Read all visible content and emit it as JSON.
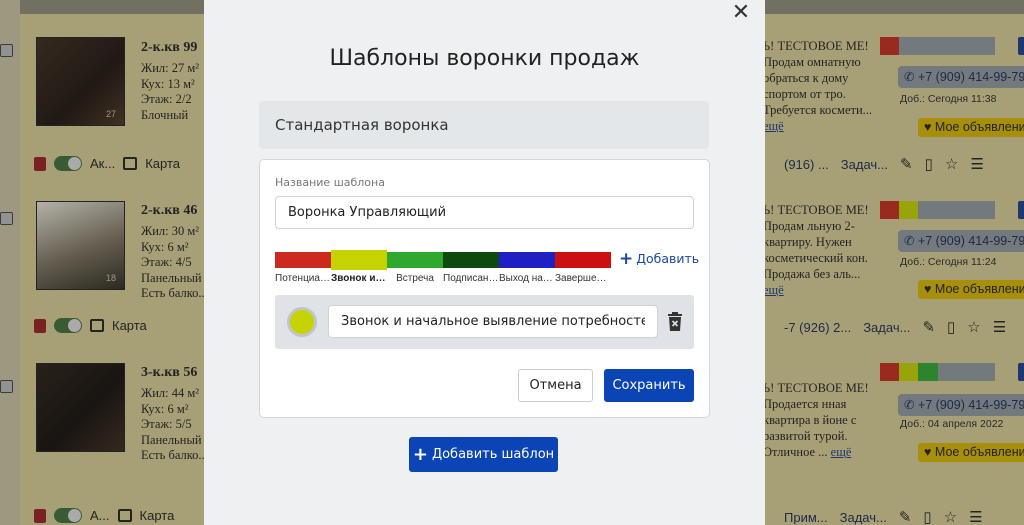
{
  "modal": {
    "title": "Шаблоны воронки продаж",
    "funnel_name": "Стандартная воронка",
    "template_label": "Название шаблона",
    "template_name": "Воронка Управляющий",
    "add_stage_label": "Добавить",
    "selected_stage": {
      "color": "#c5d400",
      "name": "Звонок и начальное выявление потребностей"
    },
    "cancel_label": "Отмена",
    "save_label": "Сохранить",
    "add_template_label": "Добавить шаблон"
  },
  "stages": [
    {
      "label": "Потенциальный клиент",
      "color": "#cc2a1e",
      "active": false
    },
    {
      "label": "Звонок и начальное выявление потребностей",
      "color": "#c5d400",
      "active": true
    },
    {
      "label": "Встреча",
      "color": "#2ea82e",
      "active": false
    },
    {
      "label": "Подписание договора",
      "color": "#0d4a0d",
      "active": false
    },
    {
      "label": "Выход на сделку",
      "color": "#1f1fc4",
      "active": false
    },
    {
      "label": "Завершение",
      "color": "#cc1010",
      "active": false
    }
  ],
  "background": {
    "listings": [
      {
        "title": "2-к.кв 99",
        "specs": "Жил: 27 м²\nКух: 13 м²\nЭтаж: 2/2\nБлочный",
        "photo_count": "27",
        "status": "Ак...",
        "map_label": "Карта",
        "desc": "Ь! ТЕСТОВОЕ МЕ! Продам омнатную обраться к дому спортом от тро. Требуется космети...",
        "more": "ещё",
        "phone": "+7 (909) 414-99-79",
        "added": "Доб.: Сегодня 11:38",
        "my_ad": "Мое объявление",
        "contact": "(916) ...",
        "tasks": "Задач..."
      },
      {
        "title": "2-к.кв 46",
        "specs": "Жил: 30 м²\nКух: 6 м²\nЭтаж: 4/5\nПанельный\nЕсть балко...",
        "photo_count": "18",
        "status": "",
        "map_label": "Карта",
        "desc": "Ь! ТЕСТОВОЕ МЕ! Продам льную 2- квартиру. Нужен косметический кон. Продажа без аль...",
        "more": "ещё",
        "phone": "+7 (909) 414-99-79",
        "added": "Доб.: Сегодня 11:24",
        "my_ad": "Мое объявление",
        "contact": "-7 (926) 2...",
        "tasks": "Задач..."
      },
      {
        "title": "3-к.кв 56",
        "specs": "Жил: 44 м²\nКух: 6 м²\nЭтаж: 5/5\nПанельный\nЕсть балко...",
        "photo_count": "",
        "status": "А...",
        "map_label": "Карта",
        "desc": "Ь! ТЕСТОВОЕ МЕ! Продается нная квартира в йоне с развитой турой. Отличное ...",
        "more": "ещё",
        "phone": "+7 (909) 414-99-79",
        "added": "Доб.: 04 апреля 2022",
        "my_ad": "Мое объявление",
        "contact": "Прим...",
        "tasks": "Задач..."
      }
    ]
  }
}
